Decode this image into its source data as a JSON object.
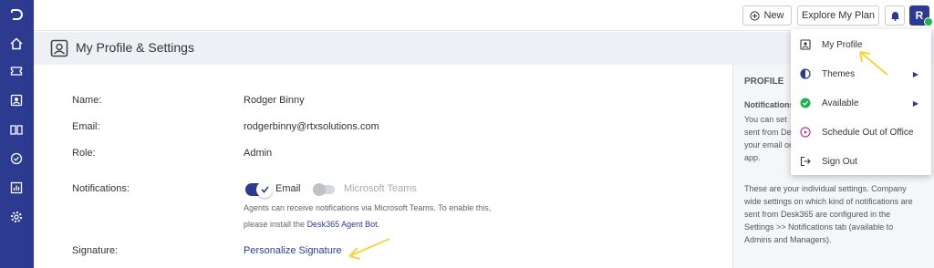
{
  "topbar": {
    "new_label": "New",
    "explore_label": "Explore My Plan",
    "avatar_initial": "R"
  },
  "header": {
    "title": "My Profile & Settings"
  },
  "profile": {
    "name_label": "Name:",
    "name_value": "Rodger Binny",
    "email_label": "Email:",
    "email_value": "rodgerbinny@rtxsolutions.com",
    "role_label": "Role:",
    "role_value": "Admin",
    "notifications_label": "Notifications:",
    "email_toggle_label": "Email",
    "email_toggle_on": true,
    "teams_toggle_label": "Microsoft Teams",
    "teams_toggle_on": false,
    "teams_note_line1": "Agents can receive notifications via Microsoft Teams. To enable this,",
    "teams_note_line2_prefix": "please install the",
    "teams_note_link": "Desk365 Agent Bot.",
    "signature_label": "Signature:",
    "signature_link": "Personalize Signature"
  },
  "right_panel": {
    "heading": "PROFILE",
    "subheading": "Notifications",
    "lines_partial": [
      "You can set",
      "sent from Des",
      "your email or",
      "app."
    ],
    "lines_full": [
      "These are your individual settings. Company",
      "wide settings on which kind of notifications are",
      "sent from Desk365 are configured in the",
      "Settings >> Notifications tab (available to",
      "Admins and Managers)."
    ]
  },
  "menu": {
    "items": [
      {
        "label": "My Profile",
        "icon": "profile-icon"
      },
      {
        "label": "Themes",
        "icon": "theme-icon",
        "submenu": true
      },
      {
        "label": "Available",
        "icon": "available-check-icon",
        "submenu": true
      },
      {
        "label": "Schedule Out of Office",
        "icon": "schedule-icon"
      },
      {
        "label": "Sign Out",
        "icon": "sign-out-icon"
      }
    ]
  },
  "colors": {
    "sidebar": "#2c3b8f",
    "accent": "#2c3b8f",
    "available_green": "#22b14c",
    "annotation_arrow": "#f5d442"
  }
}
